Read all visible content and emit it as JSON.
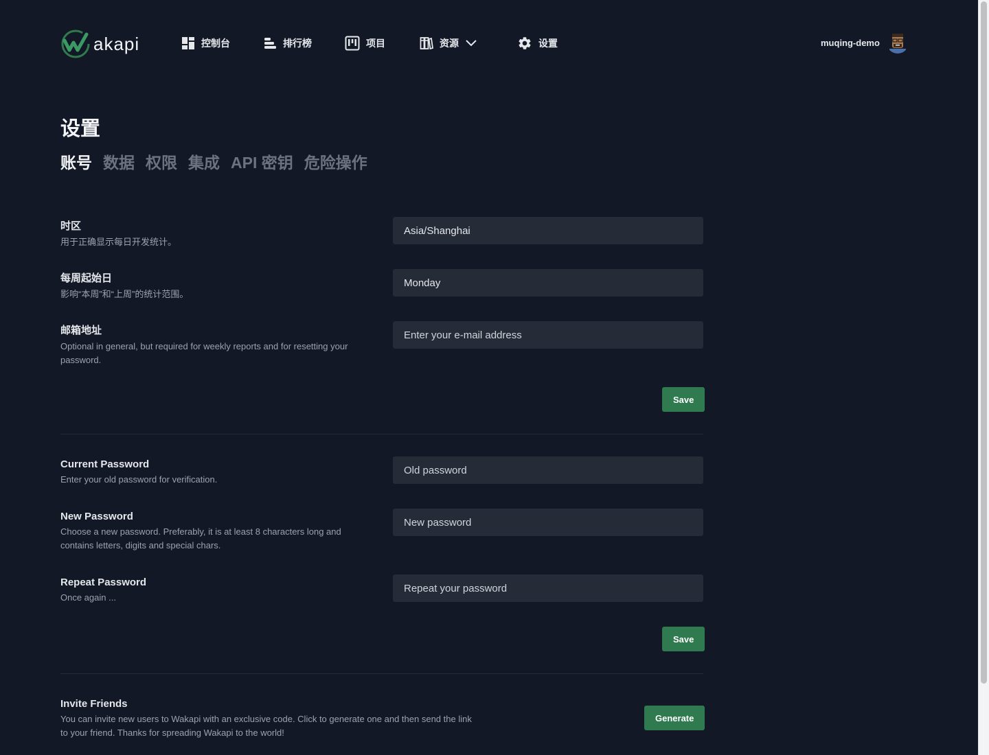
{
  "app": {
    "logo_text": "akapi",
    "username": "muqing-demo"
  },
  "nav": {
    "dashboard": "控制台",
    "leaderboard": "排行榜",
    "projects": "项目",
    "resources": "资源",
    "settings": "设置"
  },
  "page": {
    "title": "设置",
    "tabs": [
      "账号",
      "数据",
      "权限",
      "集成",
      "API 密钥",
      "危险操作"
    ],
    "active_tab": "账号"
  },
  "account": {
    "timezone": {
      "title": "时区",
      "desc": "用于正确显示每日开发统计。",
      "value": "Asia/Shanghai"
    },
    "week_start": {
      "title": "每周起始日",
      "desc": "影响“本周”和“上周”的统计范围。",
      "value": "Monday"
    },
    "email": {
      "title": "邮箱地址",
      "desc": "Optional in general, but required for weekly reports and for resetting your password.",
      "placeholder": "Enter your e-mail address"
    },
    "save_label": "Save"
  },
  "password": {
    "current": {
      "title": "Current Password",
      "desc": "Enter your old password for verification.",
      "placeholder": "Old password"
    },
    "new": {
      "title": "New Password",
      "desc": "Choose a new password. Preferably, it is at least 8 characters long and contains letters, digits and special chars.",
      "placeholder": "New password"
    },
    "repeat": {
      "title": "Repeat Password",
      "desc": "Once again ...",
      "placeholder": "Repeat your password"
    },
    "save_label": "Save"
  },
  "invite": {
    "title": "Invite Friends",
    "desc": "You can invite new users to Wakapi with an exclusive code. Click to generate one and then send the link to your friend. Thanks for spreading Wakapi to the world!",
    "button_label": "Generate"
  },
  "colors": {
    "background": "#121826",
    "input_bg": "#252b37",
    "accent_green": "#2f7a4f",
    "muted_text": "#9ca3af",
    "inactive_tab": "#6b7280"
  }
}
